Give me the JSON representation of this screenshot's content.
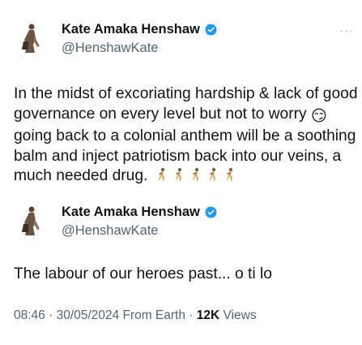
{
  "tweet": {
    "author": {
      "display_name": "Kate Amaka Henshaw",
      "handle": "@HenshawKate",
      "verified": true
    },
    "more_label": "···",
    "text_before_emoji": "In the midst of excoriating hardship & lack of good governance on every level but not to worry ",
    "emoji_1": "😏",
    "text_after_emoji": " going back to a colonial anthem will be a soothing balm and inject patriotism back into our veins, a much needed drug.",
    "runner_emojis": [
      "runner-emoji",
      "runner-emoji",
      "runner-emoji",
      "runner-emoji",
      "runner-emoji"
    ]
  },
  "quoted": {
    "author": {
      "display_name": "Kate Amaka Henshaw",
      "handle": "@HenshawKate",
      "verified": true
    },
    "text": "The labour of our heroes past... o ti lo"
  },
  "meta": {
    "time": "08:46",
    "separator": " · ",
    "date": "30/05/2024",
    "source": "From Earth",
    "views_count": "12K",
    "views_label": " Views"
  },
  "colors": {
    "verified": "#1d9bf0",
    "secondary_text": "#536471",
    "primary_text": "#0f1419"
  }
}
